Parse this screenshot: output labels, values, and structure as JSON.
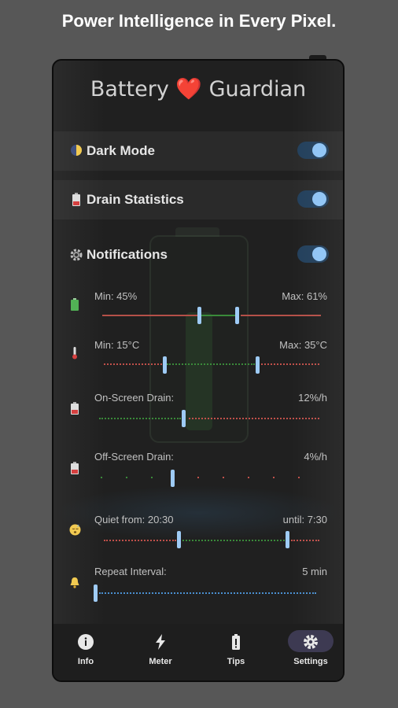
{
  "headline": "Power Intelligence in Every Pixel.",
  "app": {
    "title_left": "Battery",
    "title_heart": "❤️",
    "title_right": "Guardian"
  },
  "toggles": {
    "dark_mode": {
      "label": "Dark Mode",
      "icon": "half-moon-icon",
      "on": true
    },
    "drain_statistics": {
      "label": "Drain Statistics",
      "icon": "battery-low-icon",
      "on": true
    },
    "notifications": {
      "label": "Notifications",
      "icon": "gear-icon",
      "on": true
    }
  },
  "sliders": {
    "battery_level": {
      "min_label": "Min: 45%",
      "max_label": "Max: 61%",
      "icon": "battery-icon",
      "min": 45,
      "max": 61
    },
    "temperature": {
      "min_label": "Min: 15°C",
      "max_label": "Max: 35°C",
      "icon": "thermometer-icon",
      "min": 15,
      "max": 35
    },
    "on_screen_drain": {
      "label": "On-Screen Drain:",
      "value": "12%/h",
      "icon": "battery-low-icon"
    },
    "off_screen_drain": {
      "label": "Off-Screen Drain:",
      "value": "4%/h",
      "icon": "battery-low-icon"
    },
    "quiet_hours": {
      "from_label": "Quiet from: 20:30",
      "until_label": "until: 7:30",
      "icon": "sleeping-face-icon"
    },
    "repeat_interval": {
      "label": "Repeat Interval:",
      "value": "5 min",
      "icon": "bell-icon"
    }
  },
  "colors": {
    "accent": "#9ecbf5",
    "track_red": "#c0504a",
    "track_green": "#3a8a3a",
    "track_blue": "#4a8fd0",
    "toggle_bg": "#23405c",
    "heart": "#f0506e"
  },
  "nav": [
    {
      "label": "Info",
      "icon": "info-icon",
      "active": false
    },
    {
      "label": "Meter",
      "icon": "lightning-icon",
      "active": false
    },
    {
      "label": "Tips",
      "icon": "battery-icon",
      "active": false
    },
    {
      "label": "Settings",
      "icon": "gear-icon",
      "active": true
    }
  ]
}
